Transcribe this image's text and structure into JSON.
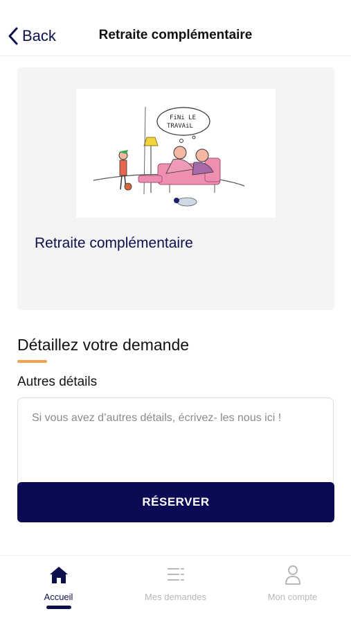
{
  "header": {
    "back_label": "Back",
    "title": "Retraite complémentaire"
  },
  "card": {
    "title": "Retraite complémentaire",
    "illustration_bubble_line1": "FiNi LE",
    "illustration_bubble_line2": "TRAVAiL"
  },
  "form": {
    "section_title": "Détaillez votre demande",
    "field_label": "Autres détails",
    "placeholder": "Si vous avez d’autres détails, écrivez- les nous ici !",
    "value": "",
    "submit_label": "RÉSERVER"
  },
  "tabbar": {
    "items": [
      {
        "label": "Accueil",
        "icon": "home-icon",
        "active": true
      },
      {
        "label": "Mes demandes",
        "icon": "list-icon",
        "active": false
      },
      {
        "label": "Mon compte",
        "icon": "user-icon",
        "active": false
      }
    ]
  },
  "colors": {
    "primary": "#0b0f4d",
    "accent": "#f5a04b",
    "card_bg": "#f4f4f4"
  }
}
